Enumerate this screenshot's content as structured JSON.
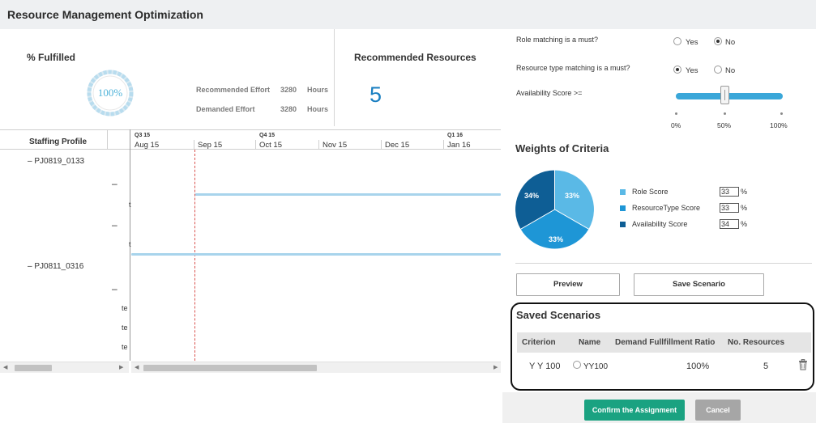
{
  "header": {
    "title": "Resource Management Optimization"
  },
  "summary": {
    "fulfilled_title": "% Fulfilled",
    "fulfilled_value": "100%",
    "fulfilled_percent": 100,
    "recommended_effort_label": "Recommended Effort",
    "recommended_effort_value": "3280",
    "demanded_effort_label": "Demanded Effort",
    "demanded_effort_value": "3280",
    "effort_unit": "Hours",
    "recommended_resources_title": "Recommended Resources",
    "recommended_resources_count": "5"
  },
  "gantt": {
    "staffing_profile_header": "Staffing Profile",
    "quarters": [
      "Q3 15",
      "Q4 15",
      "Q1 16"
    ],
    "months": [
      "Aug 15",
      "Sep 15",
      "Oct 15",
      "Nov 15",
      "Dec 15",
      "Jan 16"
    ],
    "profiles": [
      {
        "label": "PJ0819_0133",
        "toggle": "–"
      },
      {
        "label": "PJ0811_0316",
        "toggle": "–"
      }
    ],
    "row_toggle": "–",
    "truncated_t": "t",
    "truncated_te": "te"
  },
  "options": {
    "role_match_label": "Role matching is a must?",
    "role_match_selected": "No",
    "type_match_label": "Resource type matching is a must?",
    "type_match_selected": "Yes",
    "yes_label": "Yes",
    "no_label": "No",
    "availability_label": "Availability Score  >=",
    "slider_ticks": [
      "0%",
      "50%",
      "100%"
    ],
    "slider_value_percent": 50
  },
  "weights": {
    "title": "Weights of Criteria",
    "items": [
      {
        "name": "Role Score",
        "value": "33",
        "pie_label": "33%",
        "color": "#5ab9e6"
      },
      {
        "name": "ResourceType Score",
        "value": "33",
        "pie_label": "33%",
        "color": "#1e96d6"
      },
      {
        "name": "Availability Score",
        "value": "34",
        "pie_label": "34%",
        "color": "#0e5e95"
      }
    ],
    "percent_sign": "%"
  },
  "buttons": {
    "preview": "Preview",
    "save": "Save Scenario"
  },
  "saved": {
    "title": "Saved Scenarios",
    "columns": [
      "Criterion",
      "Name",
      "Demand Fullfillment Ratio",
      "No. Resources"
    ],
    "rows": [
      {
        "criterion": "Y Y 100",
        "name": "YY100",
        "ratio": "100%",
        "resources": "5"
      }
    ]
  },
  "footer": {
    "confirm": "Confirm the Assignment",
    "cancel": "Cancel"
  },
  "colors": {
    "accent_blue": "#1a7fc1",
    "confirm_green": "#1aa281",
    "today_red": "#d9534f"
  }
}
